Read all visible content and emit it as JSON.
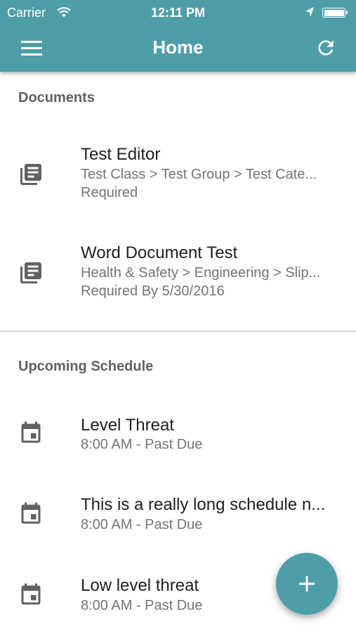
{
  "status_bar": {
    "carrier": "Carrier",
    "time": "12:11 PM"
  },
  "header": {
    "title": "Home",
    "background_color": "#4e9ea9",
    "menu_icon": "hamburger-menu-icon",
    "refresh_icon": "refresh-icon"
  },
  "documents": {
    "header": "Documents",
    "items": [
      {
        "icon": "document-list-icon",
        "title": "Test Editor",
        "path": "Test Class > Test Group > Test Cate...",
        "status": "Required"
      },
      {
        "icon": "document-list-icon",
        "title": "Word Document Test",
        "path": "Health & Safety > Engineering > Slip...",
        "status": "Required By 5/30/2016"
      }
    ]
  },
  "schedule": {
    "header": "Upcoming Schedule",
    "items": [
      {
        "icon": "calendar-event-icon",
        "title": "Level Threat",
        "time": "8:00 AM - Past Due"
      },
      {
        "icon": "calendar-event-icon",
        "title": "This is a really long schedule n...",
        "time": "8:00 AM - Past Due"
      },
      {
        "icon": "calendar-event-icon",
        "title": "Low level threat",
        "time": "8:00 AM - Past Due"
      }
    ]
  },
  "fab": {
    "icon": "plus-icon",
    "color": "#4e9ea9"
  }
}
